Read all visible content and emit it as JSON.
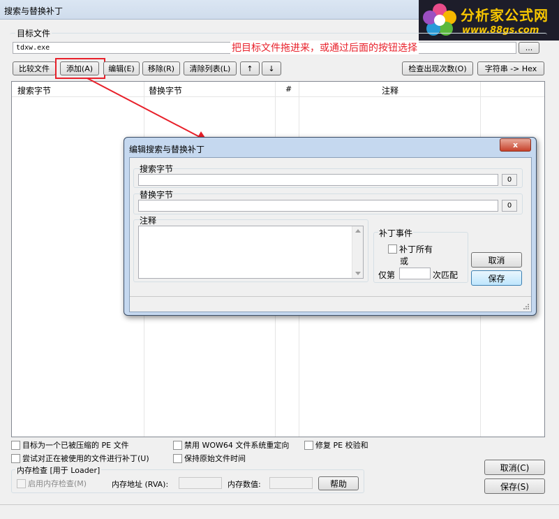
{
  "window": {
    "title": "搜索与替换补丁"
  },
  "logo": {
    "name": "分析家公式网",
    "url": "www.88gs.com"
  },
  "target": {
    "group_label": "目标文件",
    "file_value": "tdxw.exe",
    "browse_label": "...",
    "annotation": "把目标文件拖进来，或通过后面的按钮选择"
  },
  "toolbar": {
    "compare": "比较文件",
    "add": "添加(A)",
    "edit": "编辑(E)",
    "remove": "移除(R)",
    "clear": "清除列表(L)",
    "up": "↑",
    "down": "↓",
    "check": "检查出现次数(O)",
    "tohex": "字符串 -> Hex"
  },
  "table": {
    "columns": [
      "搜索字节",
      "替换字节",
      "#",
      "注释"
    ]
  },
  "dialog": {
    "title": "编辑搜索与替换补丁",
    "close": "x",
    "search_label": "搜索字节",
    "search_value": "",
    "search_count": "0",
    "replace_label": "替换字节",
    "replace_value": "",
    "replace_count": "0",
    "comment_label": "注释",
    "patch_event_label": "补丁事件",
    "patch_all": "补丁所有",
    "or": "或",
    "only_prefix": "仅第",
    "only_value": "",
    "only_suffix": "次匹配",
    "cancel": "取消",
    "save": "保存"
  },
  "options": {
    "compressed_pe": "目标为一个已被压缩的 PE 文件",
    "patch_in_use": "尝试对正在被使用的文件进行补丁(U)",
    "disable_wow64": "禁用 WOW64 文件系统重定向",
    "keep_time": "保持原始文件时间",
    "fix_checksum": "修复 PE 校验和"
  },
  "memory": {
    "group_label": "内存检查 [用于 Loader]",
    "enable": "启用内存检查(M)",
    "address_label": "内存地址 (RVA):",
    "address_value": "",
    "data_label": "内存数值:",
    "data_value": "",
    "help": "帮助"
  },
  "footer": {
    "cancel": "取消(C)",
    "save": "保存(S)"
  },
  "colors": {
    "annotation": "#e8202a",
    "highlight": "#e8202a",
    "default_button_border": "#3c7fb1"
  }
}
